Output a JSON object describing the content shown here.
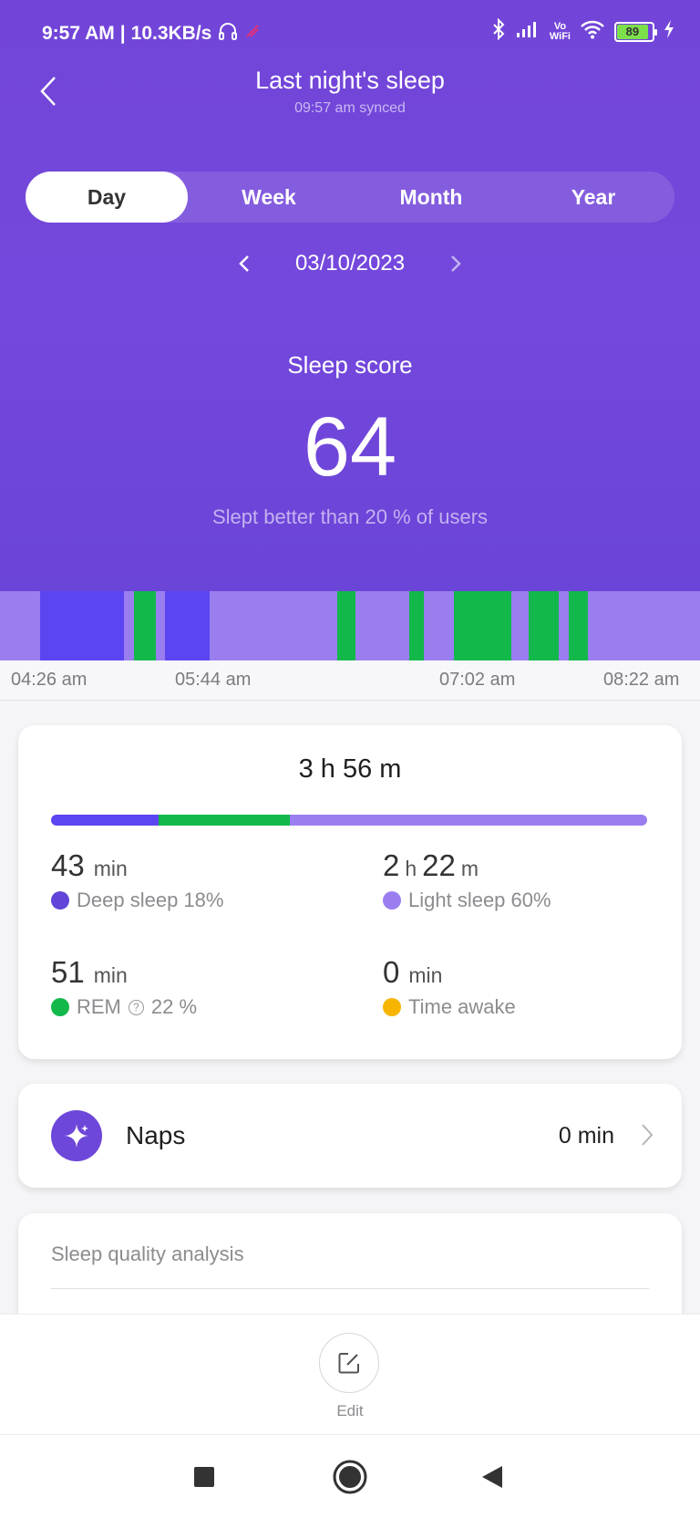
{
  "status_bar": {
    "time": "9:57 AM",
    "network_speed": "10.3KB/s",
    "battery_level": "89",
    "icons": [
      "headphones-icon",
      "cast-icon",
      "bluetooth-icon",
      "signal-icon",
      "vowifi-icon",
      "wifi-icon",
      "battery-icon",
      "charging-icon"
    ]
  },
  "header": {
    "title": "Last night's sleep",
    "subtitle": "09:57 am synced",
    "back_icon": "chevron-left-icon"
  },
  "tabs": [
    {
      "label": "Day",
      "active": true
    },
    {
      "label": "Week",
      "active": false
    },
    {
      "label": "Month",
      "active": false
    },
    {
      "label": "Year",
      "active": false
    }
  ],
  "date_nav": {
    "date": "03/10/2023"
  },
  "score": {
    "label": "Sleep score",
    "value": "64",
    "description": "Slept better than 20 % of users"
  },
  "timeline": {
    "start": "04:26 am",
    "end": "08:22 am",
    "ticks": [
      "04:26 am",
      "05:44 am",
      "07:02 am",
      "08:22 am"
    ],
    "segments": [
      {
        "stage": "light",
        "from": 0.0,
        "to": 0.057
      },
      {
        "stage": "deep",
        "from": 0.057,
        "to": 0.177
      },
      {
        "stage": "light",
        "from": 0.177,
        "to": 0.192
      },
      {
        "stage": "rem",
        "from": 0.192,
        "to": 0.223
      },
      {
        "stage": "light",
        "from": 0.223,
        "to": 0.236
      },
      {
        "stage": "deep",
        "from": 0.236,
        "to": 0.3
      },
      {
        "stage": "light",
        "from": 0.3,
        "to": 0.482
      },
      {
        "stage": "rem",
        "from": 0.482,
        "to": 0.508
      },
      {
        "stage": "light",
        "from": 0.508,
        "to": 0.585
      },
      {
        "stage": "rem",
        "from": 0.585,
        "to": 0.606
      },
      {
        "stage": "light",
        "from": 0.606,
        "to": 0.648
      },
      {
        "stage": "rem",
        "from": 0.648,
        "to": 0.73
      },
      {
        "stage": "light",
        "from": 0.73,
        "to": 0.755
      },
      {
        "stage": "rem",
        "from": 0.755,
        "to": 0.798
      },
      {
        "stage": "light",
        "from": 0.798,
        "to": 0.813
      },
      {
        "stage": "rem",
        "from": 0.813,
        "to": 0.84
      },
      {
        "stage": "light",
        "from": 0.84,
        "to": 1.0
      }
    ]
  },
  "colors": {
    "deep": "#5b45f0",
    "light": "#9a7ef0",
    "rem": "#12b84a",
    "awake": "#f7b500",
    "brand": "#7245d8"
  },
  "summary": {
    "total": "3 h 56 m",
    "distribution": {
      "deep": 18,
      "rem": 22,
      "light": 60
    },
    "stats": {
      "deep": {
        "value": "43",
        "unit": "min",
        "label": "Deep sleep 18%"
      },
      "light": {
        "hours": "2",
        "h_unit": "h",
        "minutes": "22",
        "m_unit": "m",
        "label": "Light sleep 60%"
      },
      "rem": {
        "value": "51",
        "unit": "min",
        "label": "REM",
        "percent": "22 %"
      },
      "awake": {
        "value": "0",
        "unit": "min",
        "label": "Time awake"
      }
    }
  },
  "naps": {
    "label": "Naps",
    "value": "0 min"
  },
  "quality": {
    "title": "Sleep quality analysis"
  },
  "bottom": {
    "edit_label": "Edit"
  }
}
